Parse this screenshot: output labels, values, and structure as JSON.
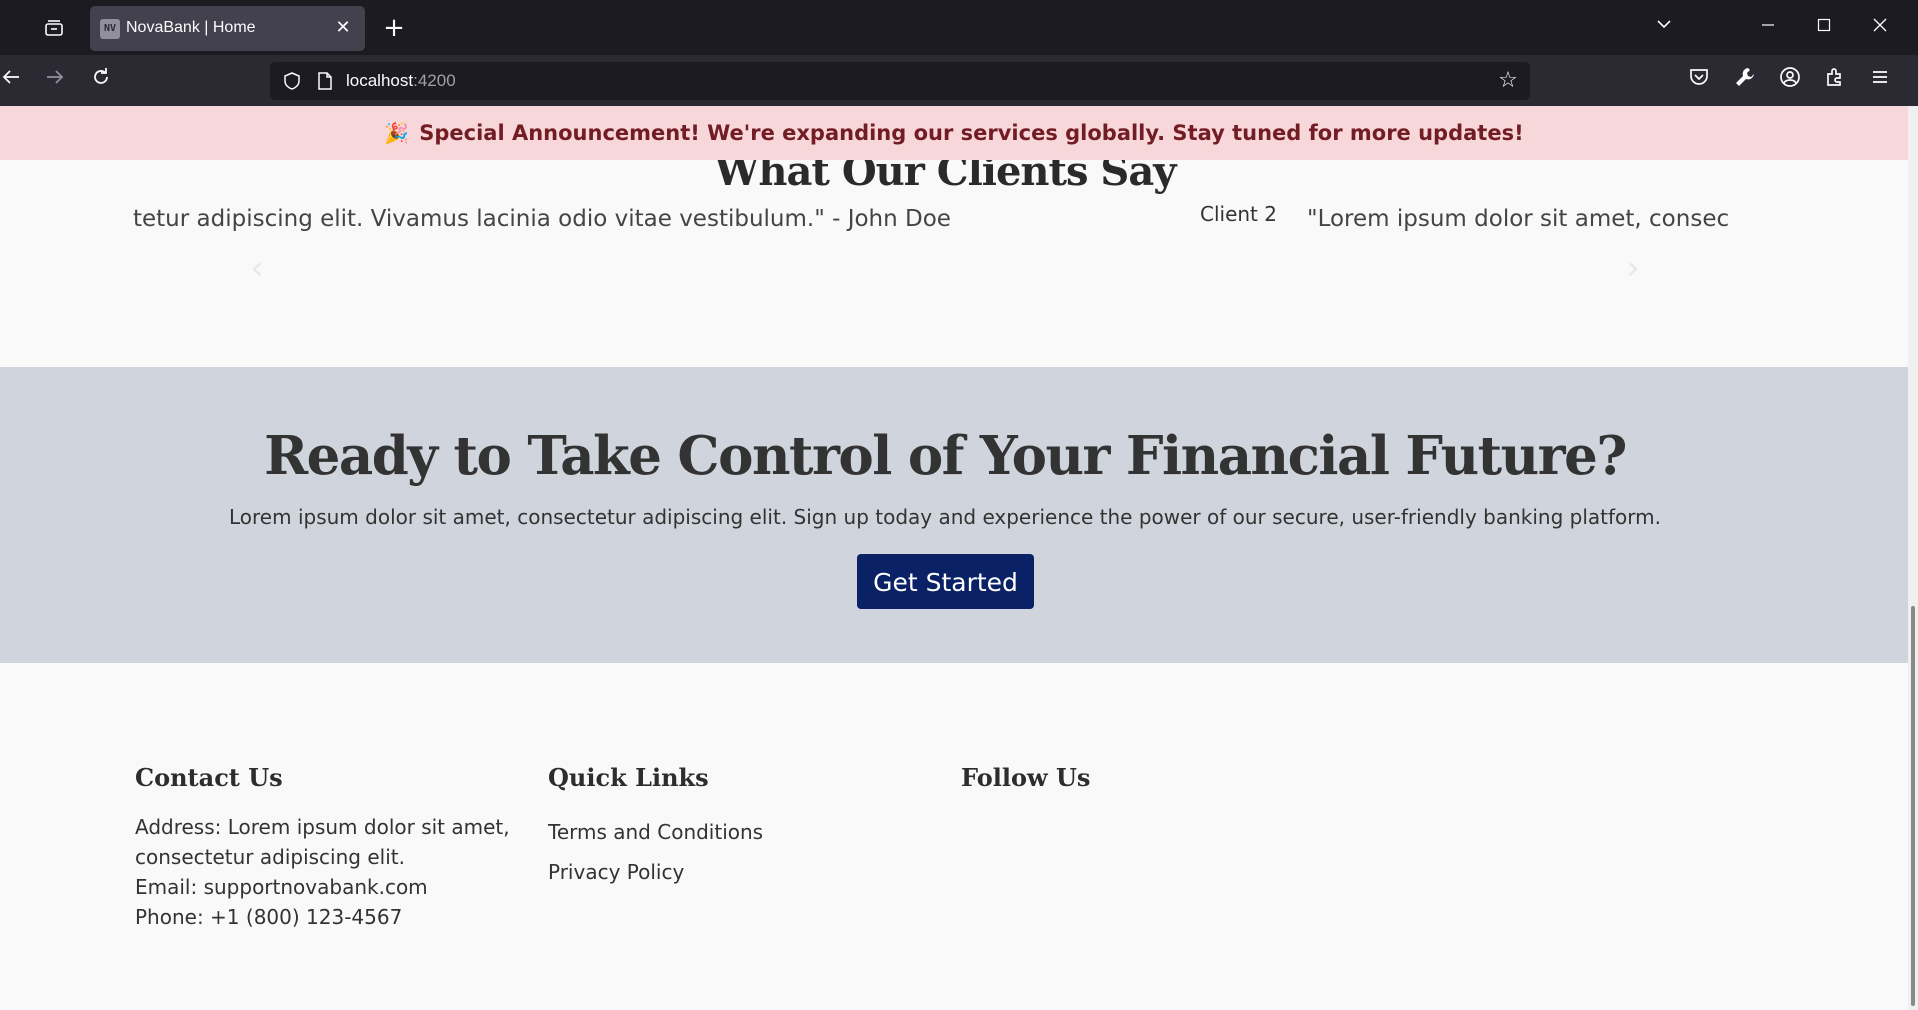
{
  "browser": {
    "tab_title": "NovaBank | Home",
    "favicon_text": "NV",
    "url_host": "localhost",
    "url_port": ":4200"
  },
  "announcement": {
    "emoji": "🎉",
    "text": "Special Announcement! We're expanding our services globally. Stay tuned for more updates!"
  },
  "testimonials": {
    "heading": "What Our Clients Say",
    "visible_quote_tail": "tetur adipiscing elit. Vivamus lacinia odio vitae vestibulum.\" - John Doe",
    "next_client_label": "Client 2",
    "next_quote_head": "\"Lorem ipsum dolor sit amet, consec"
  },
  "cta": {
    "heading": "Ready to Take Control of Your Financial Future?",
    "text": "Lorem ipsum dolor sit amet, consectetur adipiscing elit. Sign up today and experience the power of our secure, user-friendly banking platform.",
    "button_label": "Get Started"
  },
  "footer": {
    "contact": {
      "heading": "Contact Us",
      "address_1": "Address: Lorem ipsum dolor sit amet,",
      "address_2": "consectetur adipiscing elit.",
      "email": "Email: supportnovabank.com",
      "phone": "Phone: +1 (800) 123-4567"
    },
    "quick_links": {
      "heading": "Quick Links",
      "links": [
        "Terms and Conditions",
        "Privacy Policy"
      ]
    },
    "follow": {
      "heading": "Follow Us"
    }
  },
  "colors": {
    "announcement_bg": "#f8d7da",
    "announcement_text": "#721c24",
    "cta_bg": "#d0d5dd",
    "button_bg": "#0a2166"
  }
}
